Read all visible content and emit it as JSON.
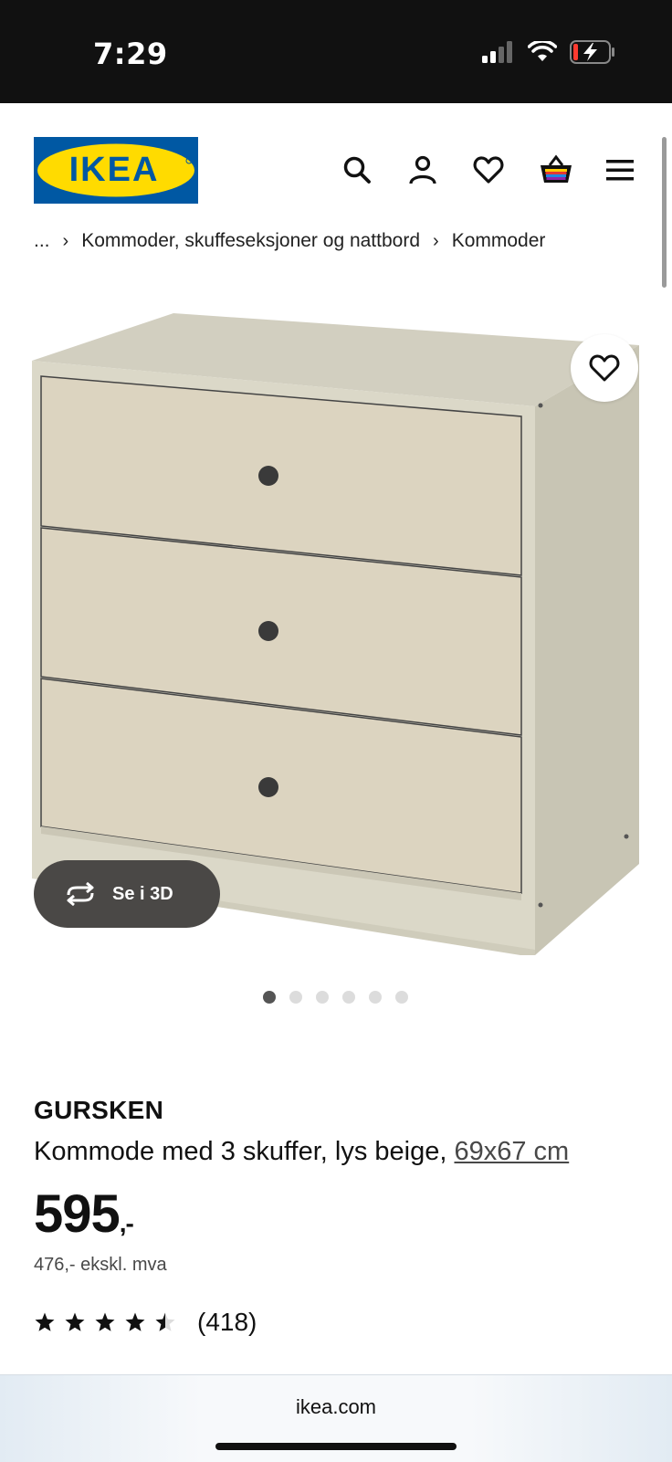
{
  "status_bar": {
    "time": "7:29"
  },
  "header": {
    "logo_text": "IKEA",
    "brand_colors": {
      "blue": "#0058a3",
      "yellow": "#ffdb00"
    },
    "icons": [
      "search-icon",
      "account-icon",
      "wishlist-icon",
      "cart-icon",
      "menu-icon"
    ]
  },
  "breadcrumb": {
    "ellipsis": "...",
    "items": [
      "Kommoder, skuffeseksjoner og nattbord",
      "Kommoder"
    ]
  },
  "gallery": {
    "view3d_label": "Se i 3D",
    "slide_count": 6,
    "active_slide": 1
  },
  "product": {
    "name": "GURSKEN",
    "description": "Kommode med 3 skuffer, lys beige,",
    "size_link": "69x67 cm",
    "price": "595",
    "price_suffix": ",-",
    "price_excl_vat": "476,- ekskl. mva",
    "rating": 4.5,
    "rating_max": 5,
    "review_count": "(418)"
  },
  "browser": {
    "url": "ikea.com"
  }
}
